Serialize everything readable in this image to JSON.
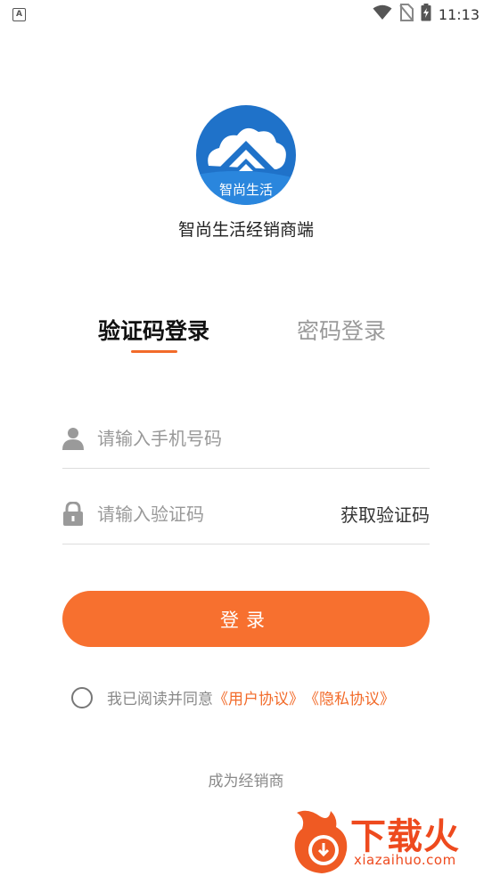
{
  "status_bar": {
    "notification_badge": "A",
    "time": "11:13",
    "icons": [
      "wifi-icon",
      "no-sim-icon",
      "battery-charging-icon"
    ]
  },
  "logo": {
    "icon": "house-cloud-logo",
    "text": "智尚生活",
    "colors": {
      "primary": "#1f72c9",
      "light": "#ffffff"
    }
  },
  "app_name": "智尚生活经销商端",
  "tabs": [
    {
      "label": "验证码登录",
      "active": true
    },
    {
      "label": "密码登录",
      "active": false
    }
  ],
  "form": {
    "phone": {
      "placeholder": "请输入手机号码",
      "value": "",
      "icon": "user-icon"
    },
    "code": {
      "placeholder": "请输入验证码",
      "value": "",
      "icon": "lock-icon"
    },
    "get_code_label": "获取验证码"
  },
  "login_button": "登录",
  "agreement": {
    "checked": false,
    "prefix": "我已阅读并同意",
    "user_agreement": "《用户协议》",
    "privacy_policy": "《隐私协议》"
  },
  "become_dealer": "成为经销商",
  "watermark": {
    "title": "下载火",
    "url": "xiazaihuo.com"
  },
  "colors": {
    "accent": "#f7702f",
    "link": "#f26b2a",
    "text": "#222222",
    "muted": "#999999"
  }
}
